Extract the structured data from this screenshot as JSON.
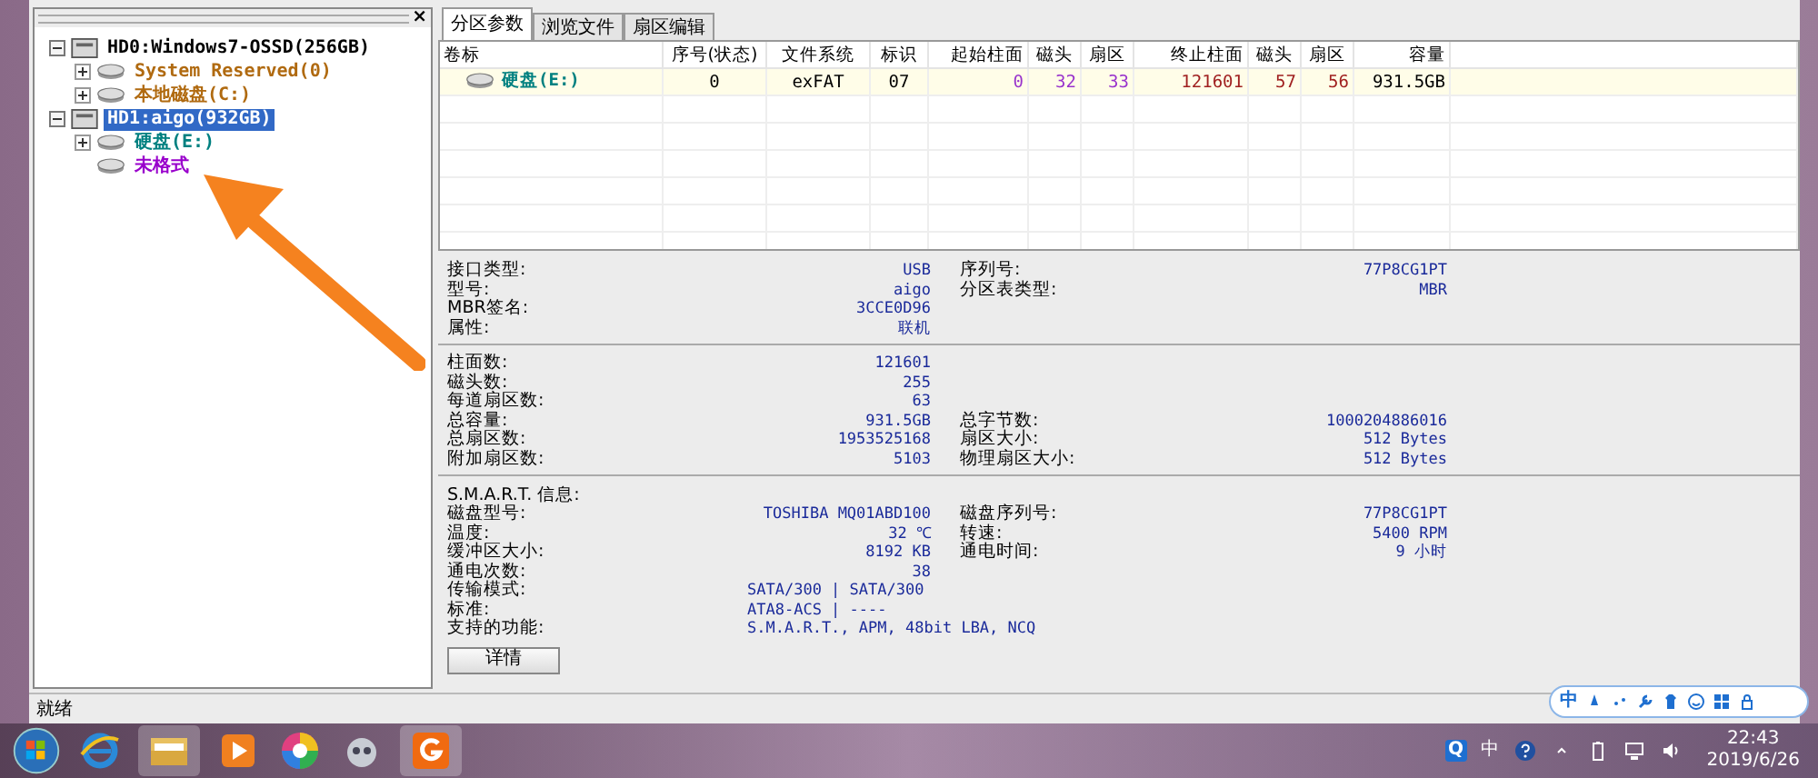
{
  "left_panel": {
    "close": "×",
    "tree": [
      {
        "label": "HD0:Windows7-OSSD(256GB)",
        "kind": "disk",
        "expanded": true,
        "selected": false,
        "children": [
          {
            "label": "System Reserved(0)",
            "kind": "partition",
            "expanded": false,
            "selected": false,
            "color": "#b06a10"
          },
          {
            "label": "本地磁盘(C:)",
            "kind": "partition",
            "expanded": false,
            "selected": false,
            "color": "#b06a10"
          }
        ]
      },
      {
        "label": "HD1:aigo(932GB)",
        "kind": "disk",
        "expanded": true,
        "selected": true,
        "children": [
          {
            "label": "硬盘(E:)",
            "kind": "partition",
            "expanded": false,
            "selected": false,
            "color": "#008080"
          },
          {
            "label": "未格式",
            "kind": "free",
            "selected": false,
            "color": "#9900cc"
          }
        ]
      }
    ]
  },
  "tabs": [
    {
      "label": "分区参数",
      "selected": true
    },
    {
      "label": "浏览文件",
      "selected": false
    },
    {
      "label": "扇区编辑",
      "selected": false
    }
  ],
  "table": {
    "columns": [
      "卷标",
      "序号(状态)",
      "文件系统",
      "标识",
      "起始柱面",
      "磁头",
      "扇区",
      "终止柱面",
      "磁头",
      "扇区",
      "容量"
    ],
    "rows": [
      [
        "硬盘(E:)",
        "0",
        "exFAT",
        "07",
        "0",
        "32",
        "33",
        "121601",
        "57",
        "56",
        "931.5GB"
      ]
    ]
  },
  "info": {
    "sections": [
      {
        "rows": [
          {
            "label": "接口类型:",
            "value": "USB",
            "label2": "序列号:",
            "value2": "77P8CG1PT"
          },
          {
            "label": "型号:",
            "value": "aigo",
            "label2": "分区表类型:",
            "value2": "MBR"
          },
          {
            "label": "MBR签名:",
            "value": "3CCE0D96"
          },
          {
            "label": "属性:",
            "value": "联机"
          }
        ]
      },
      {
        "rows": [
          {
            "label": "柱面数:",
            "value": "121601"
          },
          {
            "label": "磁头数:",
            "value": "255"
          },
          {
            "label": "每道扇区数:",
            "value": "63"
          },
          {
            "label": "总容量:",
            "value": "931.5GB",
            "label2": "总字节数:",
            "value2": "1000204886016"
          },
          {
            "label": "总扇区数:",
            "value": "1953525168",
            "label2": "扇区大小:",
            "value2": "512 Bytes"
          },
          {
            "label": "附加扇区数:",
            "value": "5103",
            "label2": "物理扇区大小:",
            "value2": "512 Bytes"
          }
        ]
      },
      {
        "title": "S.M.A.R.T. 信息:",
        "rows": [
          {
            "label": "磁盘型号:",
            "value": "TOSHIBA MQ01ABD100",
            "label2": "磁盘序列号:",
            "value2": "77P8CG1PT"
          },
          {
            "label": "温度:",
            "value": "32 ℃",
            "label2": "转速:",
            "value2": "5400 RPM"
          },
          {
            "label": "缓冲区大小:",
            "value": "8192 KB",
            "label2": "通电时间:",
            "value2": "9 小时"
          },
          {
            "label": "通电次数:",
            "value": "38"
          },
          {
            "label": "传输模式:",
            "value": "SATA/300 | SATA/300",
            "wide": true
          },
          {
            "label": "标准:",
            "value": "ATA8-ACS | ----",
            "wide": true
          },
          {
            "label": "支持的功能:",
            "value": "S.M.A.R.T., APM, 48bit LBA, NCQ",
            "wide": true
          }
        ]
      }
    ],
    "button": "详情"
  },
  "status_bar": "就绪",
  "ime_bar": {
    "lang": "中"
  },
  "tray": {
    "app": "Q",
    "ime": "中",
    "time": "22:43",
    "date": "2019/6/26"
  }
}
